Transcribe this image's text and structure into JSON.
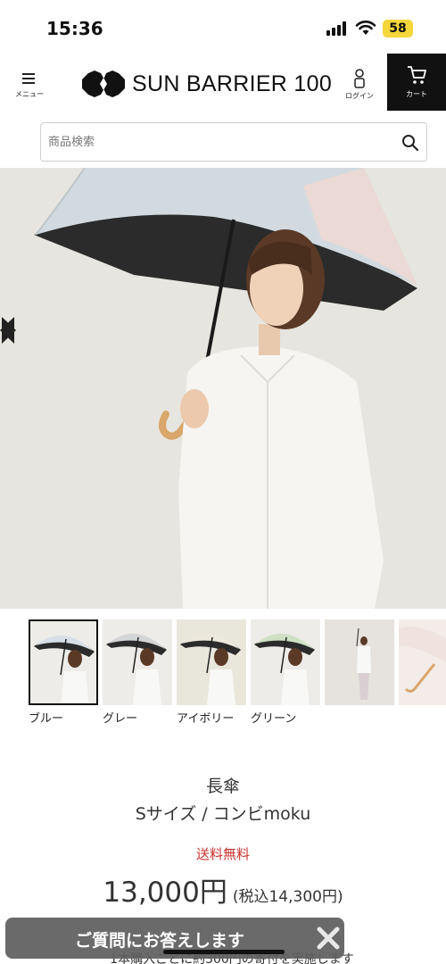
{
  "status_bar": {
    "time": "15:36",
    "battery": "58"
  },
  "header": {
    "menu_label": "メニュー",
    "brand": "SUN BARRIER 100",
    "login_label": "ログイン",
    "cart_label": "カート"
  },
  "search": {
    "placeholder": "商品検索"
  },
  "gallery": {
    "thumbnails": [
      {
        "label": "ブルー",
        "canopy": "#d7dfe6"
      },
      {
        "label": "グレー",
        "canopy": "#d3d5d6"
      },
      {
        "label": "アイボリー",
        "canopy": "#ece8dc"
      },
      {
        "label": "グリーン",
        "canopy": "#cfe0c4"
      },
      {
        "label": "",
        "canopy": "#e6e2de"
      },
      {
        "label": "",
        "canopy": "#f0e3df"
      }
    ]
  },
  "product": {
    "category": "長傘",
    "name": "Sサイズ / コンビmoku",
    "shipping": "送料無料",
    "price": "13,000円",
    "price_tax": "(税込14,300円)"
  },
  "bottom": {
    "partial_text": "1本購入ごとに約300円の寄付を実施します"
  },
  "chat": {
    "label": "ご質問にお答えします"
  },
  "colors": {
    "accent_red": "#c9302c",
    "cart_bg": "#111111",
    "battery": "#f5d63b"
  }
}
